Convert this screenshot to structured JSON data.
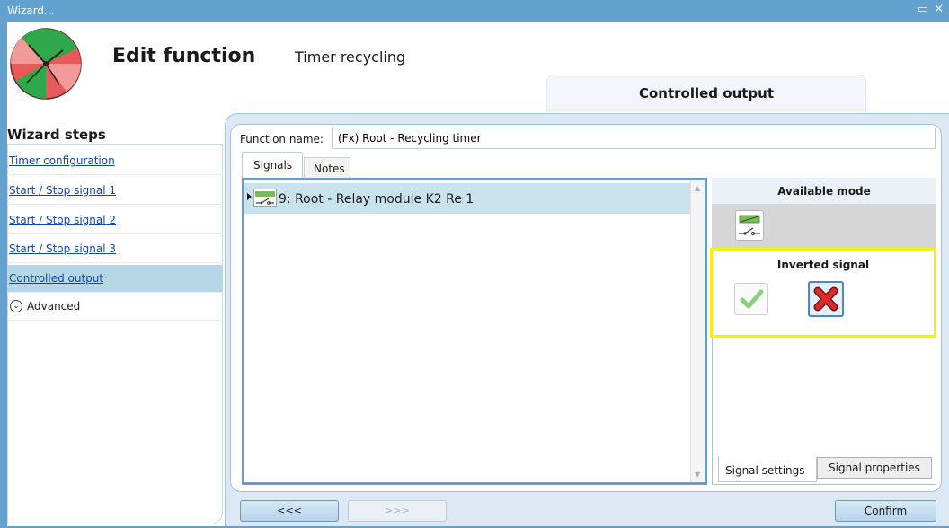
{
  "window": {
    "title": "Wizard...",
    "controls": [
      "restore-icon",
      "close-icon"
    ]
  },
  "header": {
    "title": "Edit function",
    "subtitle": "Timer recycling",
    "step_tab": "Controlled output"
  },
  "sidebar": {
    "heading": "Wizard steps",
    "items": [
      {
        "label": "Timer configuration"
      },
      {
        "label": "Start / Stop signal 1"
      },
      {
        "label": "Start / Stop signal 2"
      },
      {
        "label": "Start / Stop signal 3"
      },
      {
        "label": "Controlled output"
      }
    ],
    "active_item": "Controlled output",
    "advanced_label": "Advanced"
  },
  "form": {
    "function_name_label": "Function name:",
    "function_name_value": "(Fx) Root - Recycling timer"
  },
  "tabs": {
    "signals": "Signals",
    "notes": "Notes"
  },
  "signals_list": [
    {
      "icon": "relay-icon",
      "label": "9: Root - Relay module K2 Re 1"
    }
  ],
  "side_panel": {
    "available_mode_title": "Available mode",
    "available_mode_icon": "relay-icon",
    "inverted_signal_title": "Inverted signal",
    "inverted_selected": "no",
    "bottom_tabs": [
      "Signal settings",
      "Signal properties"
    ]
  },
  "navigation": {
    "prev_label": "<<<",
    "next_label": ">>>",
    "confirm_label": "Confirm"
  },
  "colors": {
    "titlebar": "#63a1cf",
    "active_step": "#b5d6e6",
    "highlight_frame": "#f5f011",
    "list_selection": "#c8e2ee"
  }
}
